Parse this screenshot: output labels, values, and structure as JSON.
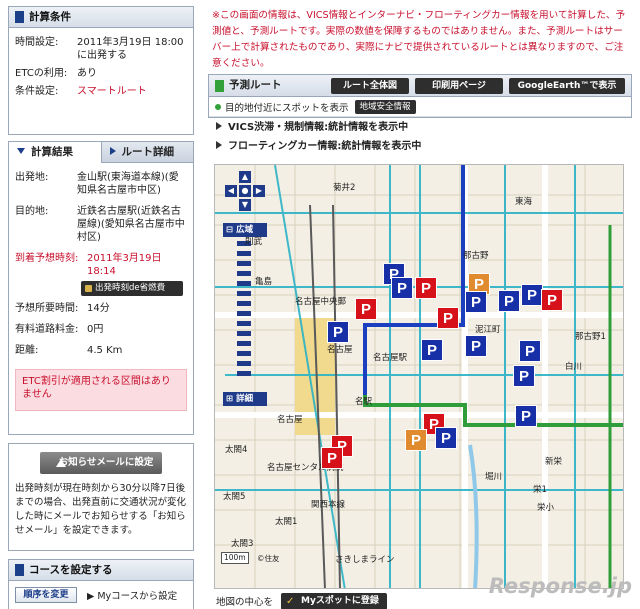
{
  "conditions": {
    "title": "計算条件",
    "time_label": "時間設定:",
    "time_value": "2011年3月19日 18:00",
    "time_value2": "に出発する",
    "etc_label": "ETCの利用:",
    "etc_value": "あり",
    "cond_label": "条件設定:",
    "cond_value": "スマートルート"
  },
  "tabs": [
    {
      "label": "計算結果",
      "active": true
    },
    {
      "label": "ルート詳細",
      "active": false
    }
  ],
  "result": {
    "origin_label": "出発地:",
    "origin_value": "金山駅(東海道本線)(愛知県名古屋市中区)",
    "dest_label": "目的地:",
    "dest_value": "近鉄名古屋駅(近鉄名古屋線)(愛知県名古屋市中村区)",
    "arrival_label": "到着予想時刻:",
    "arrival_value": "2011年3月19日 18:14",
    "save_button": "出発時刻de省燃費",
    "duration_label": "予想所要時間:",
    "duration_value": "14分",
    "toll_label": "有料道路料金:",
    "toll_value": "0円",
    "distance_label": "距離:",
    "distance_value": "4.5 Km",
    "etc_notice": "ETC割引が適用される区間はありません"
  },
  "notify": {
    "button": "お知らせメールに設定",
    "text": "出発時刻が現在時刻から30分以降7日後までの場合、出発直前に交通状況が変化した時にメールでお知らせする「お知らせメール」を設定できます。"
  },
  "course": {
    "title": "コースを設定する",
    "order_button": "順序を変更",
    "mycourse_link": "▶ Myコースから設定"
  },
  "notice": "※この画面の情報は、VICS情報とインターナビ・フローティングカー情報を用いて計算した、予測値と、予測ルートです。実際の数値を保障するものではありません。また、予測ルートはサーバー上で計算されたものであり、実際にナビで提供されているルートとは異なりますので、ご注意ください。",
  "route": {
    "title": "予測ルート",
    "buttons": [
      "ルート全体図",
      "印刷用ページ",
      "GoogleEarth™で表示"
    ],
    "spot_text": "目的地付近にスポットを表示",
    "safety_button": "地域安全情報",
    "vics_link": "VICS渋滞・規制情報:統計情報を表示中",
    "floating_link": "フローティングカー情報:統計情報を表示中"
  },
  "map": {
    "zoom_wide": "広域",
    "zoom_detail": "詳細",
    "scale": "100m",
    "copyright": "©住友",
    "labels": [
      "菊井2",
      "那古野",
      "名古屋中央郵",
      "名古屋",
      "名古屋駅",
      "亀島",
      "泥江町",
      "那古野1",
      "則武",
      "名駅",
      "新栄",
      "名古屋",
      "太閤4",
      "名古屋センタル病院",
      "太閤5",
      "太閤1",
      "太閤3",
      "関西本線",
      "さきしまライン",
      "堀川",
      "栄1",
      "栄小",
      "白川",
      "東海"
    ],
    "footer_text": "地図の中心を",
    "myspot_button": "Myスポットに登録"
  },
  "watermark": "Response.jp",
  "colors": {
    "accent_blue": "#1c3f8a",
    "notice_red": "#c8102e",
    "route_green": "#33a13a",
    "parking_blue": "#1730a8",
    "parking_red": "#d6111a",
    "parking_orange": "#e08b2e"
  }
}
